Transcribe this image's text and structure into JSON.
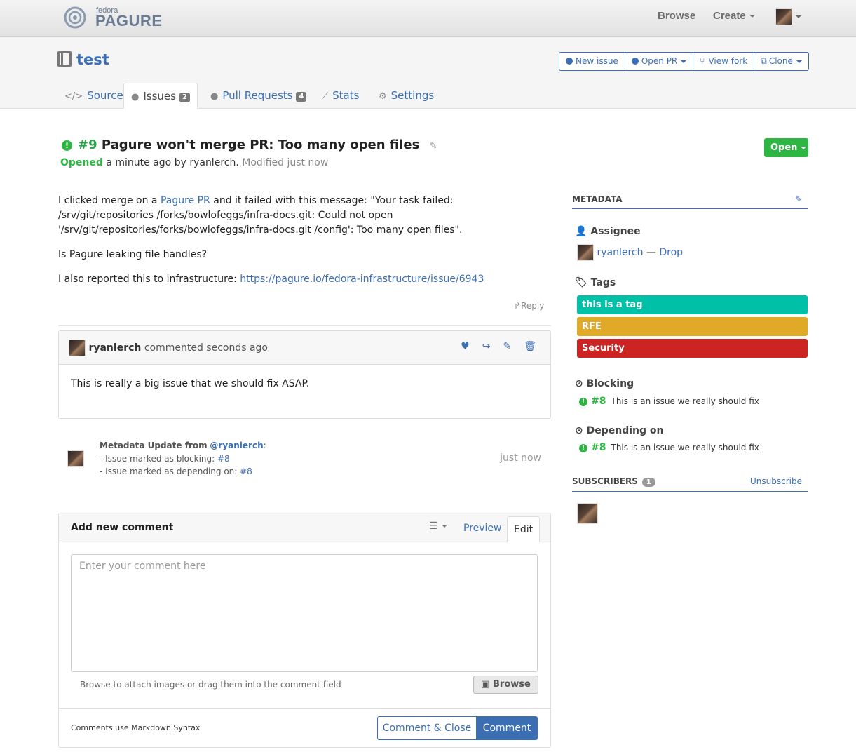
{
  "topnav": {
    "logo_small": "fedora",
    "logo_big": "PAGURE",
    "browse": "Browse",
    "create": "Create"
  },
  "repo": {
    "name": "test",
    "buttons": {
      "new_issue": "New issue",
      "open_pr": "Open PR",
      "view_fork": "View fork",
      "clone": "Clone"
    },
    "tabs": {
      "source": "Source",
      "issues": "Issues",
      "issues_count": "2",
      "pull_requests": "Pull Requests",
      "pr_count": "4",
      "stats": "Stats",
      "settings": "Settings"
    }
  },
  "issue": {
    "number": "#9",
    "title": "Pagure won't merge PR: Too many open files",
    "opened_label": "Opened",
    "opened_text": "a minute ago by ryanlerch.",
    "modified_text": "Modified just now",
    "status_button": "Open",
    "body": {
      "p1_before": "I clicked merge on a ",
      "p1_link": "Pagure PR",
      "p1_after": " and it failed with this message: \"Your task failed: /srv/git/repositories /forks/bowlofeggs/infra-docs.git: Could not open '/srv/git/repositories/forks/bowlofeggs/infra-docs.git /config': Too many open files\".",
      "p2": "Is Pagure leaking file handles?",
      "p3_before": "I also reported this to infrastructure: ",
      "p3_link": "https://pagure.io/fedora-infrastructure/issue/6943"
    },
    "reply_label": "Reply"
  },
  "comment": {
    "author": "ryanlerch",
    "when": "commented seconds ago",
    "text": "This is really a big issue that we should fix ASAP."
  },
  "meta_update": {
    "header": "Metadata Update from",
    "user": "@ryanlerch",
    "line1_prefix": "- Issue marked as blocking: ",
    "line1_link": "#8",
    "line2_prefix": "- Issue marked as depending on: ",
    "line2_link": "#8",
    "time": "just now"
  },
  "add_comment": {
    "title": "Add new comment",
    "preview_tab": "Preview",
    "edit_tab": "Edit",
    "placeholder": "Enter your comment here",
    "attach_text": "Browse to attach images or drag them into the comment field",
    "browse_button": "Browse",
    "markdown_note": "Comments use Markdown Syntax",
    "comment_close_button": "Comment & Close",
    "comment_button": "Comment"
  },
  "sidebar": {
    "metadata_title": "METADATA",
    "assignee_label": "Assignee",
    "assignee_name": "ryanlerch",
    "assignee_sep": "—",
    "drop_label": "Drop",
    "tags_label": "Tags",
    "tags": [
      {
        "name": "this is a tag",
        "color": "#00c1a8"
      },
      {
        "name": "RFE",
        "color": "#e0aa28"
      },
      {
        "name": "Security",
        "color": "#cc2323"
      }
    ],
    "blocking_label": "Blocking",
    "blocking_num": "#8",
    "blocking_title": "This is an issue we really should fix",
    "depending_label": "Depending on",
    "depending_num": "#8",
    "depending_title": "This is an issue we really should fix",
    "subscribers_title": "SUBSCRIBERS",
    "subscribers_count": "1",
    "unsubscribe": "Unsubscribe"
  },
  "colors": {
    "link": "#3c6eb4",
    "open_green": "#2db742"
  }
}
